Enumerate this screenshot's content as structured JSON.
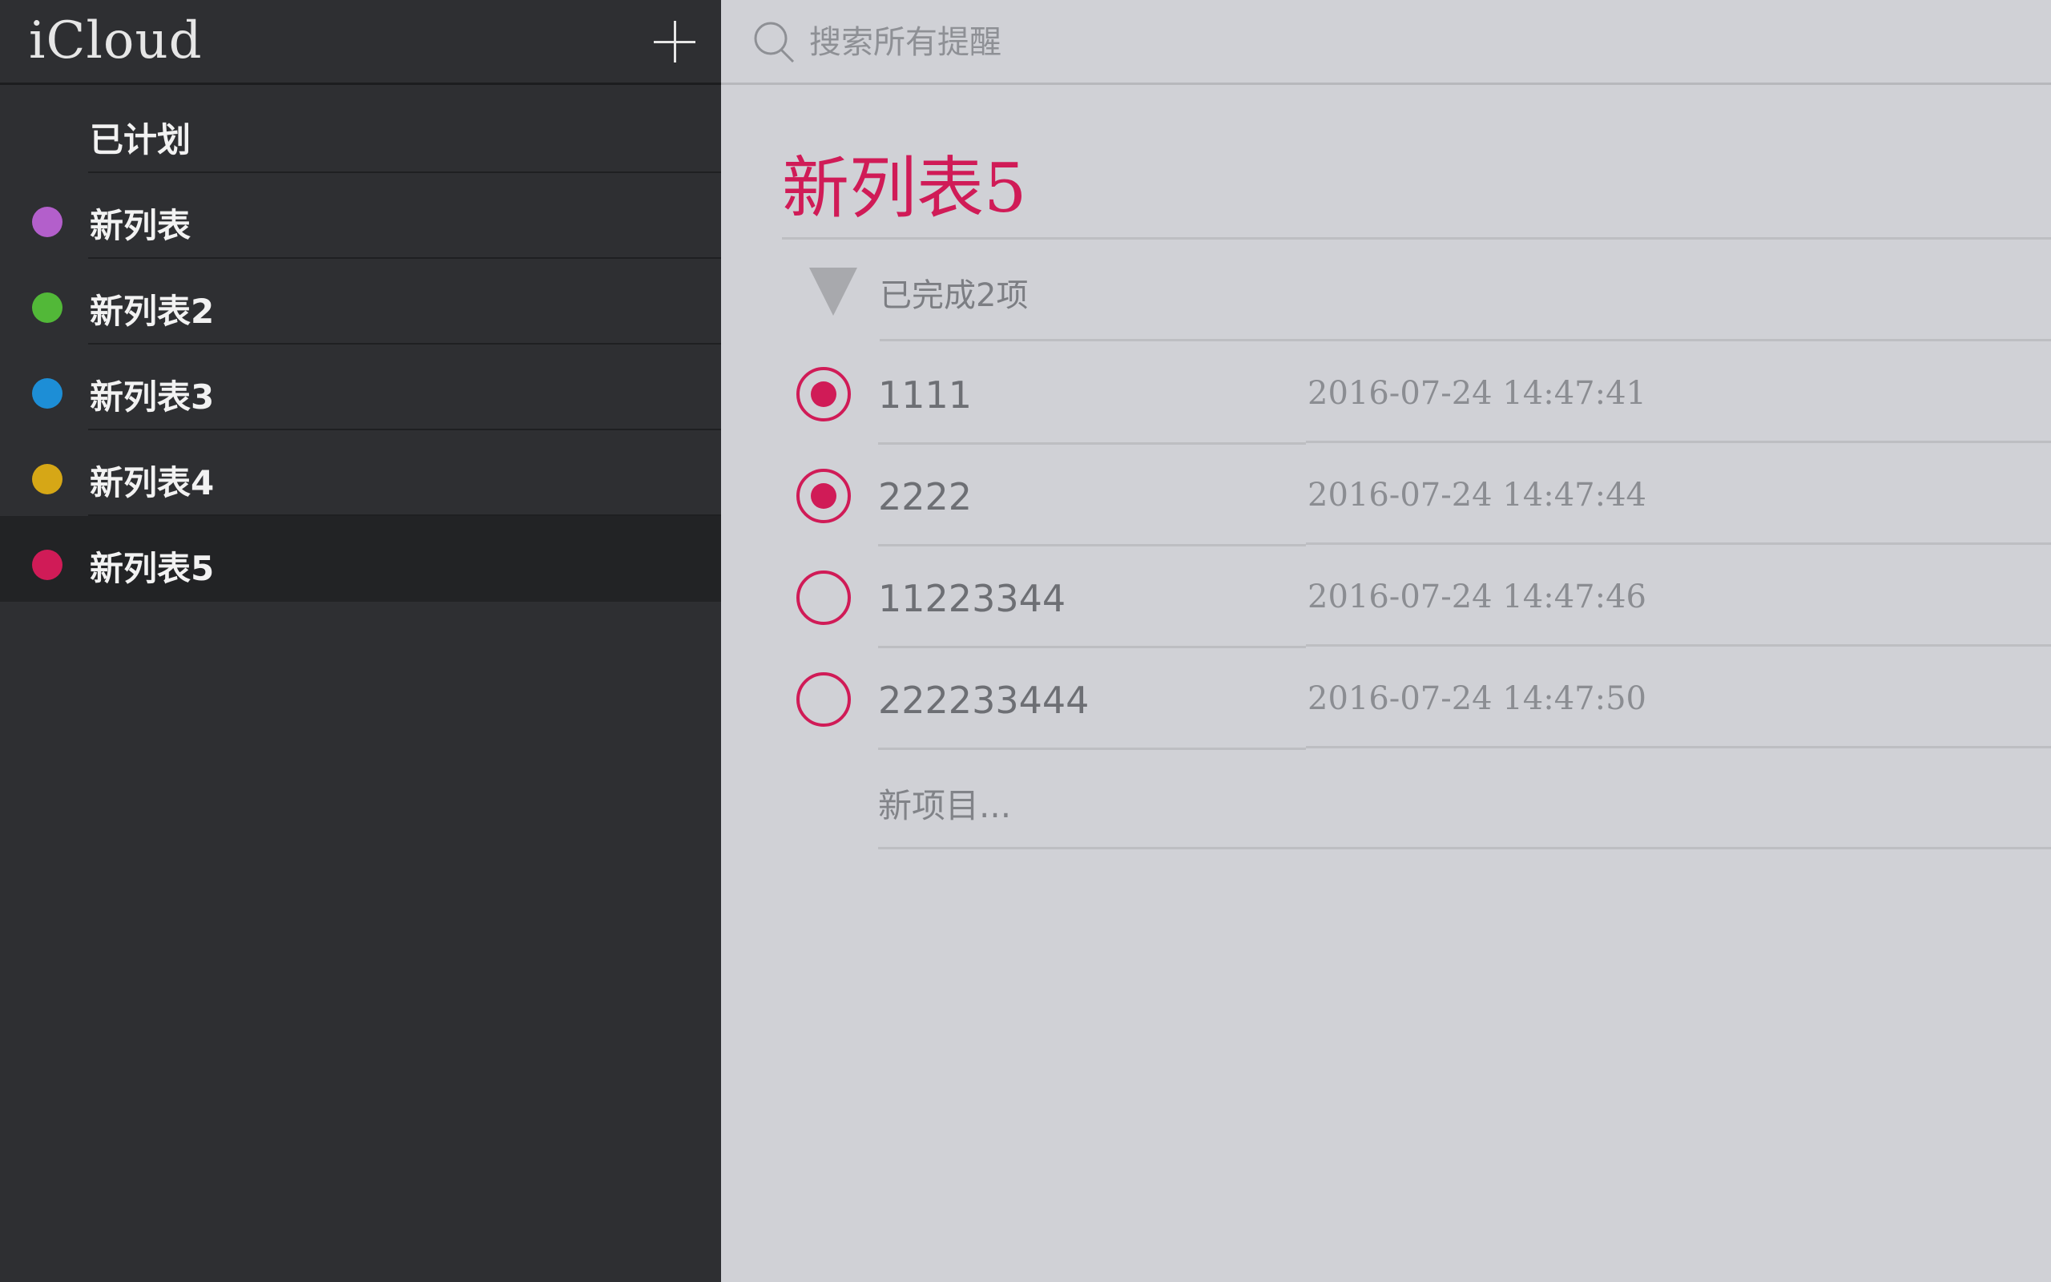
{
  "sidebar": {
    "title": "iCloud",
    "add_icon": "plus-icon",
    "items": [
      {
        "label": "已计划",
        "color": null
      },
      {
        "label": "新列表",
        "color": "#b35fcb"
      },
      {
        "label": "新列表2",
        "color": "#52b838"
      },
      {
        "label": "新列表3",
        "color": "#1d8ed6"
      },
      {
        "label": "新列表4",
        "color": "#d6a716"
      },
      {
        "label": "新列表5",
        "color": "#d01b57",
        "selected": true
      }
    ]
  },
  "search": {
    "placeholder": "搜索所有提醒",
    "icon": "search-icon"
  },
  "main": {
    "list_title": "新列表5",
    "accent_color": "#d01b57",
    "completed_label": "已完成2项",
    "tasks": [
      {
        "title": "1111",
        "date": "2016-07-24 14:47:41",
        "completed": true
      },
      {
        "title": "2222",
        "date": "2016-07-24 14:47:44",
        "completed": true
      },
      {
        "title": "11223344",
        "date": "2016-07-24 14:47:46",
        "completed": false
      },
      {
        "title": "222233444",
        "date": "2016-07-24 14:47:50",
        "completed": false
      }
    ],
    "new_item_label": "新项目..."
  }
}
